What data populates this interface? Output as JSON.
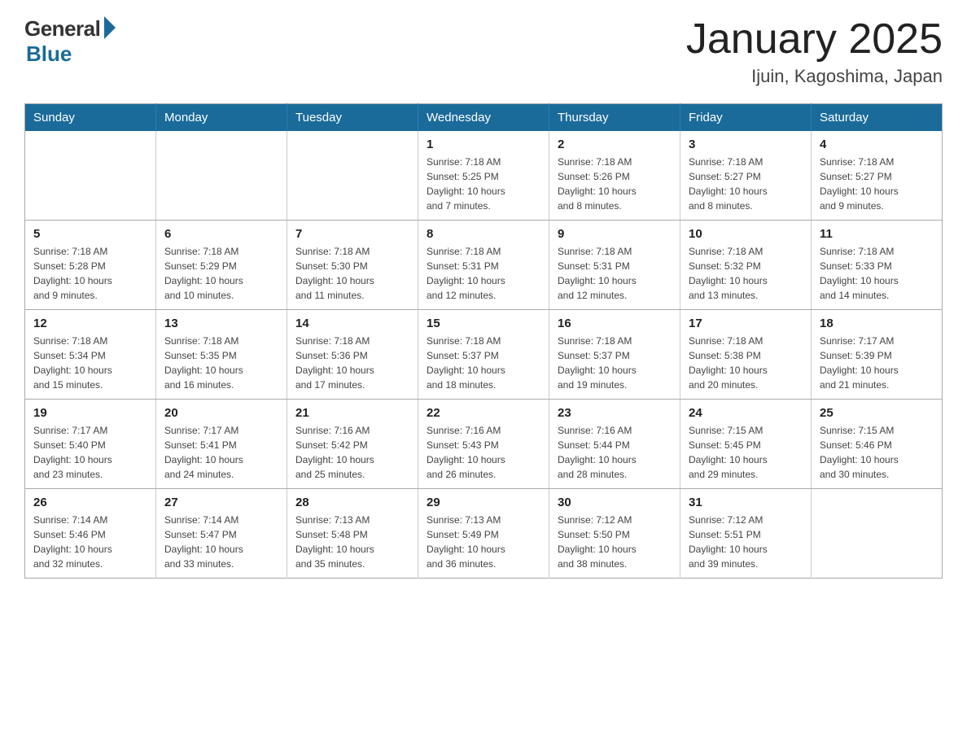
{
  "logo": {
    "general": "General",
    "blue": "Blue"
  },
  "header": {
    "title": "January 2025",
    "subtitle": "Ijuin, Kagoshima, Japan"
  },
  "weekdays": [
    "Sunday",
    "Monday",
    "Tuesday",
    "Wednesday",
    "Thursday",
    "Friday",
    "Saturday"
  ],
  "weeks": [
    [
      {
        "day": "",
        "info": ""
      },
      {
        "day": "",
        "info": ""
      },
      {
        "day": "",
        "info": ""
      },
      {
        "day": "1",
        "info": "Sunrise: 7:18 AM\nSunset: 5:25 PM\nDaylight: 10 hours\nand 7 minutes."
      },
      {
        "day": "2",
        "info": "Sunrise: 7:18 AM\nSunset: 5:26 PM\nDaylight: 10 hours\nand 8 minutes."
      },
      {
        "day": "3",
        "info": "Sunrise: 7:18 AM\nSunset: 5:27 PM\nDaylight: 10 hours\nand 8 minutes."
      },
      {
        "day": "4",
        "info": "Sunrise: 7:18 AM\nSunset: 5:27 PM\nDaylight: 10 hours\nand 9 minutes."
      }
    ],
    [
      {
        "day": "5",
        "info": "Sunrise: 7:18 AM\nSunset: 5:28 PM\nDaylight: 10 hours\nand 9 minutes."
      },
      {
        "day": "6",
        "info": "Sunrise: 7:18 AM\nSunset: 5:29 PM\nDaylight: 10 hours\nand 10 minutes."
      },
      {
        "day": "7",
        "info": "Sunrise: 7:18 AM\nSunset: 5:30 PM\nDaylight: 10 hours\nand 11 minutes."
      },
      {
        "day": "8",
        "info": "Sunrise: 7:18 AM\nSunset: 5:31 PM\nDaylight: 10 hours\nand 12 minutes."
      },
      {
        "day": "9",
        "info": "Sunrise: 7:18 AM\nSunset: 5:31 PM\nDaylight: 10 hours\nand 12 minutes."
      },
      {
        "day": "10",
        "info": "Sunrise: 7:18 AM\nSunset: 5:32 PM\nDaylight: 10 hours\nand 13 minutes."
      },
      {
        "day": "11",
        "info": "Sunrise: 7:18 AM\nSunset: 5:33 PM\nDaylight: 10 hours\nand 14 minutes."
      }
    ],
    [
      {
        "day": "12",
        "info": "Sunrise: 7:18 AM\nSunset: 5:34 PM\nDaylight: 10 hours\nand 15 minutes."
      },
      {
        "day": "13",
        "info": "Sunrise: 7:18 AM\nSunset: 5:35 PM\nDaylight: 10 hours\nand 16 minutes."
      },
      {
        "day": "14",
        "info": "Sunrise: 7:18 AM\nSunset: 5:36 PM\nDaylight: 10 hours\nand 17 minutes."
      },
      {
        "day": "15",
        "info": "Sunrise: 7:18 AM\nSunset: 5:37 PM\nDaylight: 10 hours\nand 18 minutes."
      },
      {
        "day": "16",
        "info": "Sunrise: 7:18 AM\nSunset: 5:37 PM\nDaylight: 10 hours\nand 19 minutes."
      },
      {
        "day": "17",
        "info": "Sunrise: 7:18 AM\nSunset: 5:38 PM\nDaylight: 10 hours\nand 20 minutes."
      },
      {
        "day": "18",
        "info": "Sunrise: 7:17 AM\nSunset: 5:39 PM\nDaylight: 10 hours\nand 21 minutes."
      }
    ],
    [
      {
        "day": "19",
        "info": "Sunrise: 7:17 AM\nSunset: 5:40 PM\nDaylight: 10 hours\nand 23 minutes."
      },
      {
        "day": "20",
        "info": "Sunrise: 7:17 AM\nSunset: 5:41 PM\nDaylight: 10 hours\nand 24 minutes."
      },
      {
        "day": "21",
        "info": "Sunrise: 7:16 AM\nSunset: 5:42 PM\nDaylight: 10 hours\nand 25 minutes."
      },
      {
        "day": "22",
        "info": "Sunrise: 7:16 AM\nSunset: 5:43 PM\nDaylight: 10 hours\nand 26 minutes."
      },
      {
        "day": "23",
        "info": "Sunrise: 7:16 AM\nSunset: 5:44 PM\nDaylight: 10 hours\nand 28 minutes."
      },
      {
        "day": "24",
        "info": "Sunrise: 7:15 AM\nSunset: 5:45 PM\nDaylight: 10 hours\nand 29 minutes."
      },
      {
        "day": "25",
        "info": "Sunrise: 7:15 AM\nSunset: 5:46 PM\nDaylight: 10 hours\nand 30 minutes."
      }
    ],
    [
      {
        "day": "26",
        "info": "Sunrise: 7:14 AM\nSunset: 5:46 PM\nDaylight: 10 hours\nand 32 minutes."
      },
      {
        "day": "27",
        "info": "Sunrise: 7:14 AM\nSunset: 5:47 PM\nDaylight: 10 hours\nand 33 minutes."
      },
      {
        "day": "28",
        "info": "Sunrise: 7:13 AM\nSunset: 5:48 PM\nDaylight: 10 hours\nand 35 minutes."
      },
      {
        "day": "29",
        "info": "Sunrise: 7:13 AM\nSunset: 5:49 PM\nDaylight: 10 hours\nand 36 minutes."
      },
      {
        "day": "30",
        "info": "Sunrise: 7:12 AM\nSunset: 5:50 PM\nDaylight: 10 hours\nand 38 minutes."
      },
      {
        "day": "31",
        "info": "Sunrise: 7:12 AM\nSunset: 5:51 PM\nDaylight: 10 hours\nand 39 minutes."
      },
      {
        "day": "",
        "info": ""
      }
    ]
  ]
}
